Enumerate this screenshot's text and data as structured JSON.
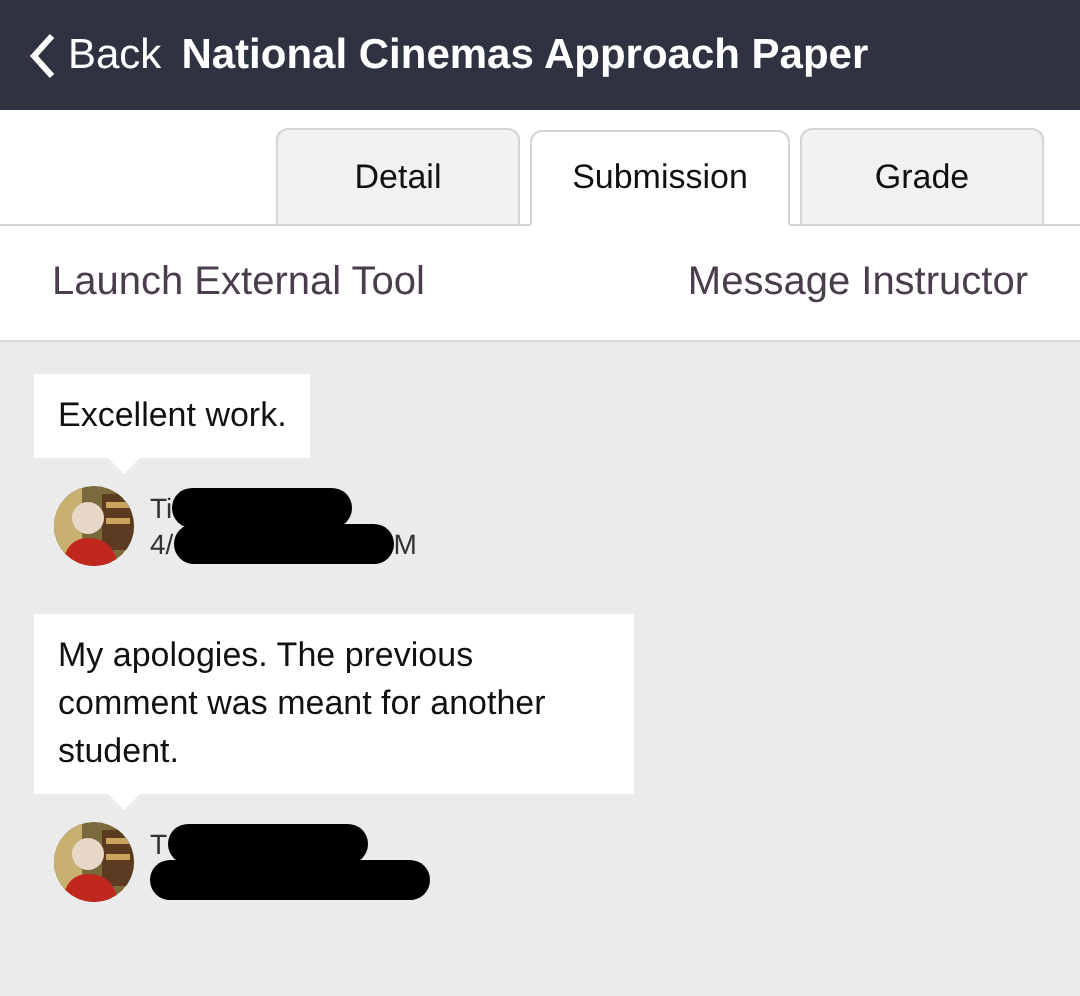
{
  "nav": {
    "back_label": "Back",
    "title": "National Cinemas Approach Paper"
  },
  "tabs": [
    {
      "label": "Detail",
      "selected": false
    },
    {
      "label": "Submission",
      "selected": true
    },
    {
      "label": "Grade",
      "selected": false
    }
  ],
  "actions": [
    "Launch External Tool",
    "Message Instructor"
  ],
  "comments": [
    {
      "text": "Excellent work.",
      "author_visible": "Ti",
      "date_visible": "4/",
      "date_end_visible": "M"
    },
    {
      "text": "My apologies. The previous comment was meant for another student.",
      "author_visible": "T"
    }
  ]
}
